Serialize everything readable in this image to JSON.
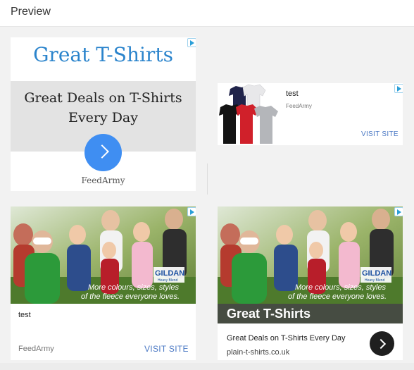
{
  "header": {
    "title": "Preview"
  },
  "ads": [
    {
      "id": "ad1",
      "headline": "Great T-Shirts",
      "description": "Great Deals on T-Shirts Every Day",
      "brand": "FeedArmy",
      "icons": [
        "adchoices-icon",
        "chevron-right-icon"
      ],
      "accent": "#3f8ef2",
      "headline_color": "#2b84cc"
    },
    {
      "id": "ad2",
      "title": "test",
      "brand": "FeedArmy",
      "cta": "VISIT SITE",
      "image": "t-shirts-product-image"
    },
    {
      "id": "ad3",
      "title": "test",
      "brand": "FeedArmy",
      "cta": "VISIT SITE",
      "image": "family-lifestyle-photo",
      "photo_caption_line1": "More colours, sizes, styles",
      "photo_caption_line2": "of the fleece everyone loves.",
      "photo_logo": "GILDAN",
      "photo_logo_sub": "Heavy Blend"
    },
    {
      "id": "ad4",
      "headline": "Great T-Shirts",
      "description": "Great Deals on T-Shirts Every Day",
      "url": "plain-t-shirts.co.uk",
      "image": "family-lifestyle-photo",
      "photo_caption_line1": "More colours, sizes, styles",
      "photo_caption_line2": "of the fleece everyone loves.",
      "photo_logo": "GILDAN",
      "photo_logo_sub": "Heavy Blend"
    }
  ]
}
